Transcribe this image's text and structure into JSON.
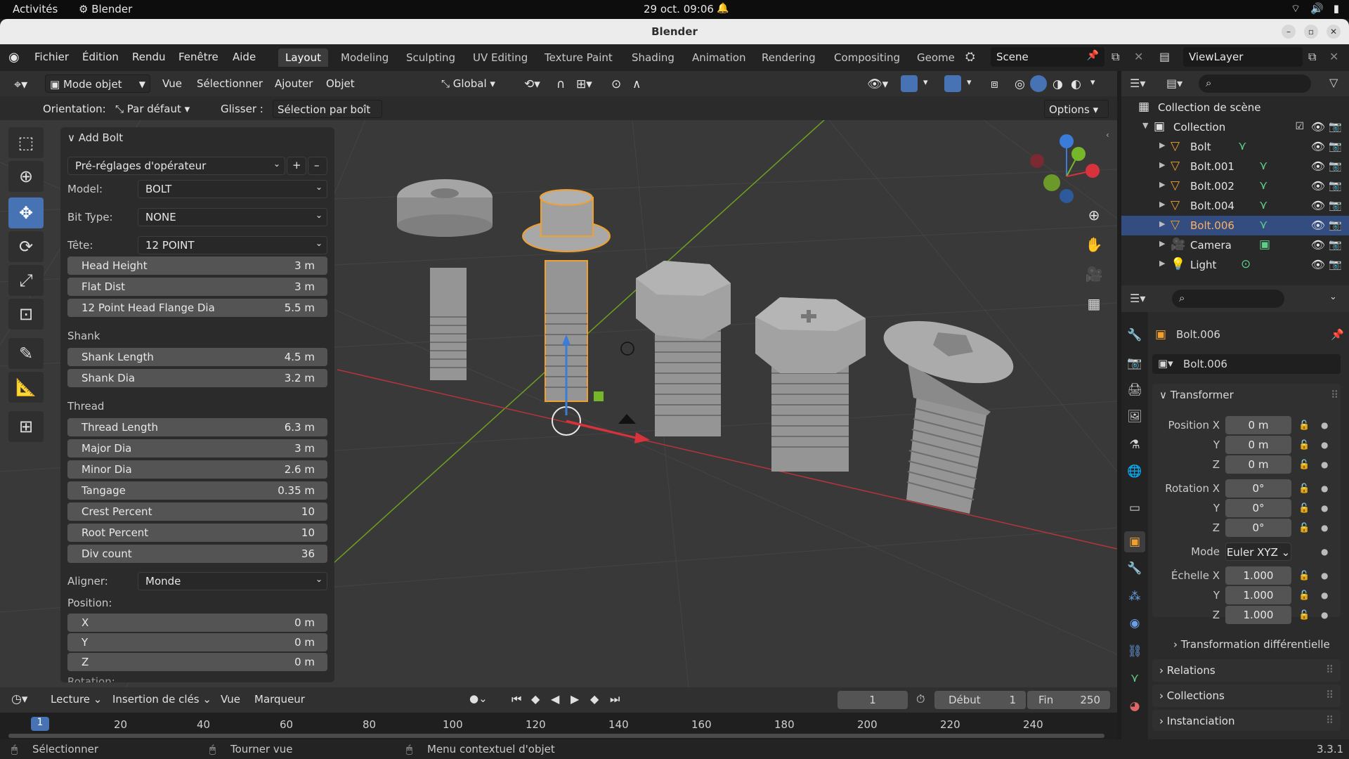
{
  "gnome": {
    "activities": "Activités",
    "app": "Blender",
    "clock": "29 oct.  09:06"
  },
  "window": {
    "title": "Blender"
  },
  "menubar": [
    "Fichier",
    "Édition",
    "Rendu",
    "Fenêtre",
    "Aide"
  ],
  "workspaces": [
    "Layout",
    "Modeling",
    "Sculpting",
    "UV Editing",
    "Texture Paint",
    "Shading",
    "Animation",
    "Rendering",
    "Compositing",
    "Geome"
  ],
  "scene": "Scene",
  "viewlayer": "ViewLayer",
  "viewport_header": {
    "mode": "Mode objet",
    "vue": "Vue",
    "select": "Sélectionner",
    "add": "Ajouter",
    "object": "Objet",
    "transform": "Global"
  },
  "tool_settings": {
    "orientation_label": "Orientation:",
    "orientation": "Par défaut",
    "drag_label": "Glisser :",
    "drag": "Sélection par boît",
    "options": "Options"
  },
  "redo_panel": {
    "title": "Add Bolt",
    "presets": "Pré-réglages d'opérateur",
    "model_label": "Model:",
    "model": "BOLT",
    "bittype_label": "Bit Type:",
    "bittype": "NONE",
    "head_label": "Tête:",
    "head": "12 POINT",
    "head_fields": [
      {
        "l": "Head Height",
        "v": "3 m"
      },
      {
        "l": "Flat Dist",
        "v": "3 m"
      },
      {
        "l": "12 Point Head Flange Dia",
        "v": "5.5 m"
      }
    ],
    "shank_label": "Shank",
    "shank_fields": [
      {
        "l": "Shank Length",
        "v": "4.5 m"
      },
      {
        "l": "Shank Dia",
        "v": "3.2 m"
      }
    ],
    "thread_label": "Thread",
    "thread_fields": [
      {
        "l": "Thread Length",
        "v": "6.3 m"
      },
      {
        "l": "Major Dia",
        "v": "3 m"
      },
      {
        "l": "Minor Dia",
        "v": "2.6 m"
      },
      {
        "l": "Tangage",
        "v": "0.35 m"
      },
      {
        "l": "Crest Percent",
        "v": "10"
      },
      {
        "l": "Root Percent",
        "v": "10"
      },
      {
        "l": "Div count",
        "v": "36"
      }
    ],
    "align_label": "Aligner:",
    "align": "Monde",
    "position_label": "Position:",
    "position_fields": [
      {
        "l": "X",
        "v": "0 m"
      },
      {
        "l": "Y",
        "v": "0 m"
      },
      {
        "l": "Z",
        "v": "0 m"
      }
    ],
    "rotation_label": "Rotation:"
  },
  "outliner": {
    "root": "Collection de scène",
    "collection": "Collection",
    "items": [
      "Bolt",
      "Bolt.001",
      "Bolt.002",
      "Bolt.004",
      "Bolt.006",
      "Camera",
      "Light"
    ],
    "selected": "Bolt.006"
  },
  "properties": {
    "object": "Bolt.006",
    "object_field": "Bolt.006",
    "transform_title": "Transformer",
    "position_label": "Position X",
    "rotation_label": "Rotation X",
    "scale_label": "Échelle X",
    "y": "Y",
    "z": "Z",
    "mode_label": "Mode",
    "loc": [
      "0 m",
      "0 m",
      "0 m"
    ],
    "rot": [
      "0°",
      "0°",
      "0°"
    ],
    "mode": "Euler XYZ",
    "scale": [
      "1.000",
      "1.000",
      "1.000"
    ],
    "delta": "Transformation différentielle",
    "relations": "Relations",
    "collections": "Collections",
    "instancing": "Instanciation"
  },
  "timeline": {
    "playback": "Lecture",
    "keying": "Insertion de clés",
    "view": "Vue",
    "markers": "Marqueur",
    "current": "1",
    "start_label": "Début",
    "start": "1",
    "end_label": "Fin",
    "end": "250",
    "ticks": [
      "1",
      "20",
      "40",
      "60",
      "80",
      "100",
      "120",
      "140",
      "160",
      "180",
      "200",
      "220",
      "240"
    ]
  },
  "status": {
    "select": "Sélectionner",
    "rotate": "Tourner vue",
    "context": "Menu contextuel d'objet",
    "version": "3.3.1"
  },
  "colors": {
    "accent": "#4772b3",
    "selected_row": "#334d80",
    "selection_outline": "#f0a030",
    "axis_x": "#d8323c",
    "axis_y": "#76b62a",
    "axis_z": "#3a7cd8"
  }
}
